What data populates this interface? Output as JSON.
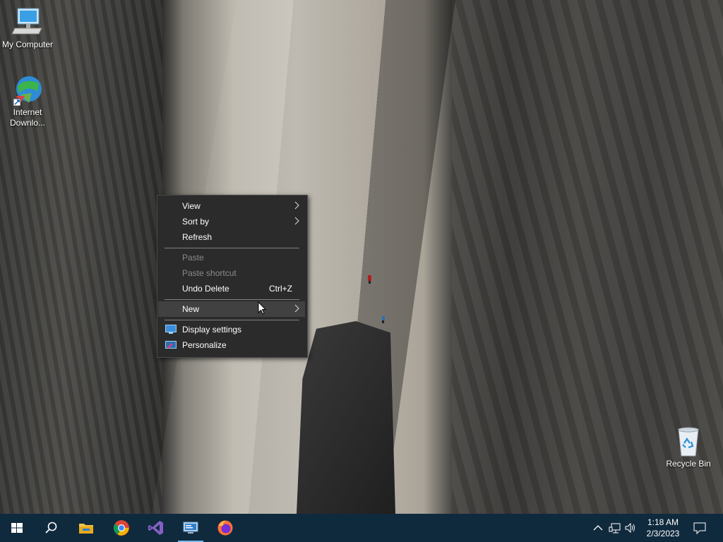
{
  "desktop": {
    "icons": [
      {
        "label": "My Computer",
        "icon": "computer-icon"
      },
      {
        "label": "Internet Downlo...",
        "icon": "idm-globe-icon"
      },
      {
        "label": "Recycle Bin",
        "icon": "recycle-bin-icon"
      }
    ]
  },
  "context_menu": {
    "items": [
      {
        "label": "View",
        "submenu": true
      },
      {
        "label": "Sort by",
        "submenu": true
      },
      {
        "label": "Refresh"
      },
      {
        "label": "Paste",
        "disabled": true
      },
      {
        "label": "Paste shortcut",
        "disabled": true
      },
      {
        "label": "Undo Delete",
        "shortcut": "Ctrl+Z"
      },
      {
        "label": "New",
        "submenu": true,
        "highlighted": true
      },
      {
        "label": "Display settings",
        "icon": "display-settings-icon"
      },
      {
        "label": "Personalize",
        "icon": "personalize-icon"
      }
    ]
  },
  "taskbar": {
    "pinned": [
      "start-icon",
      "search-icon",
      "file-explorer-icon",
      "chrome-icon",
      "visual-studio-icon",
      "remote-desktop-icon",
      "firefox-icon"
    ],
    "tray": {
      "icons": [
        "chevron-up-icon",
        "network-icon",
        "volume-icon",
        "notification-icon"
      ],
      "time": "1:18 AM",
      "date": "2/3/2023"
    }
  },
  "colors": {
    "menu_bg": "#2b2b2b",
    "menu_hover": "#414141",
    "taskbar_bg": "#102a3d",
    "active_indicator": "#76b9ed"
  }
}
